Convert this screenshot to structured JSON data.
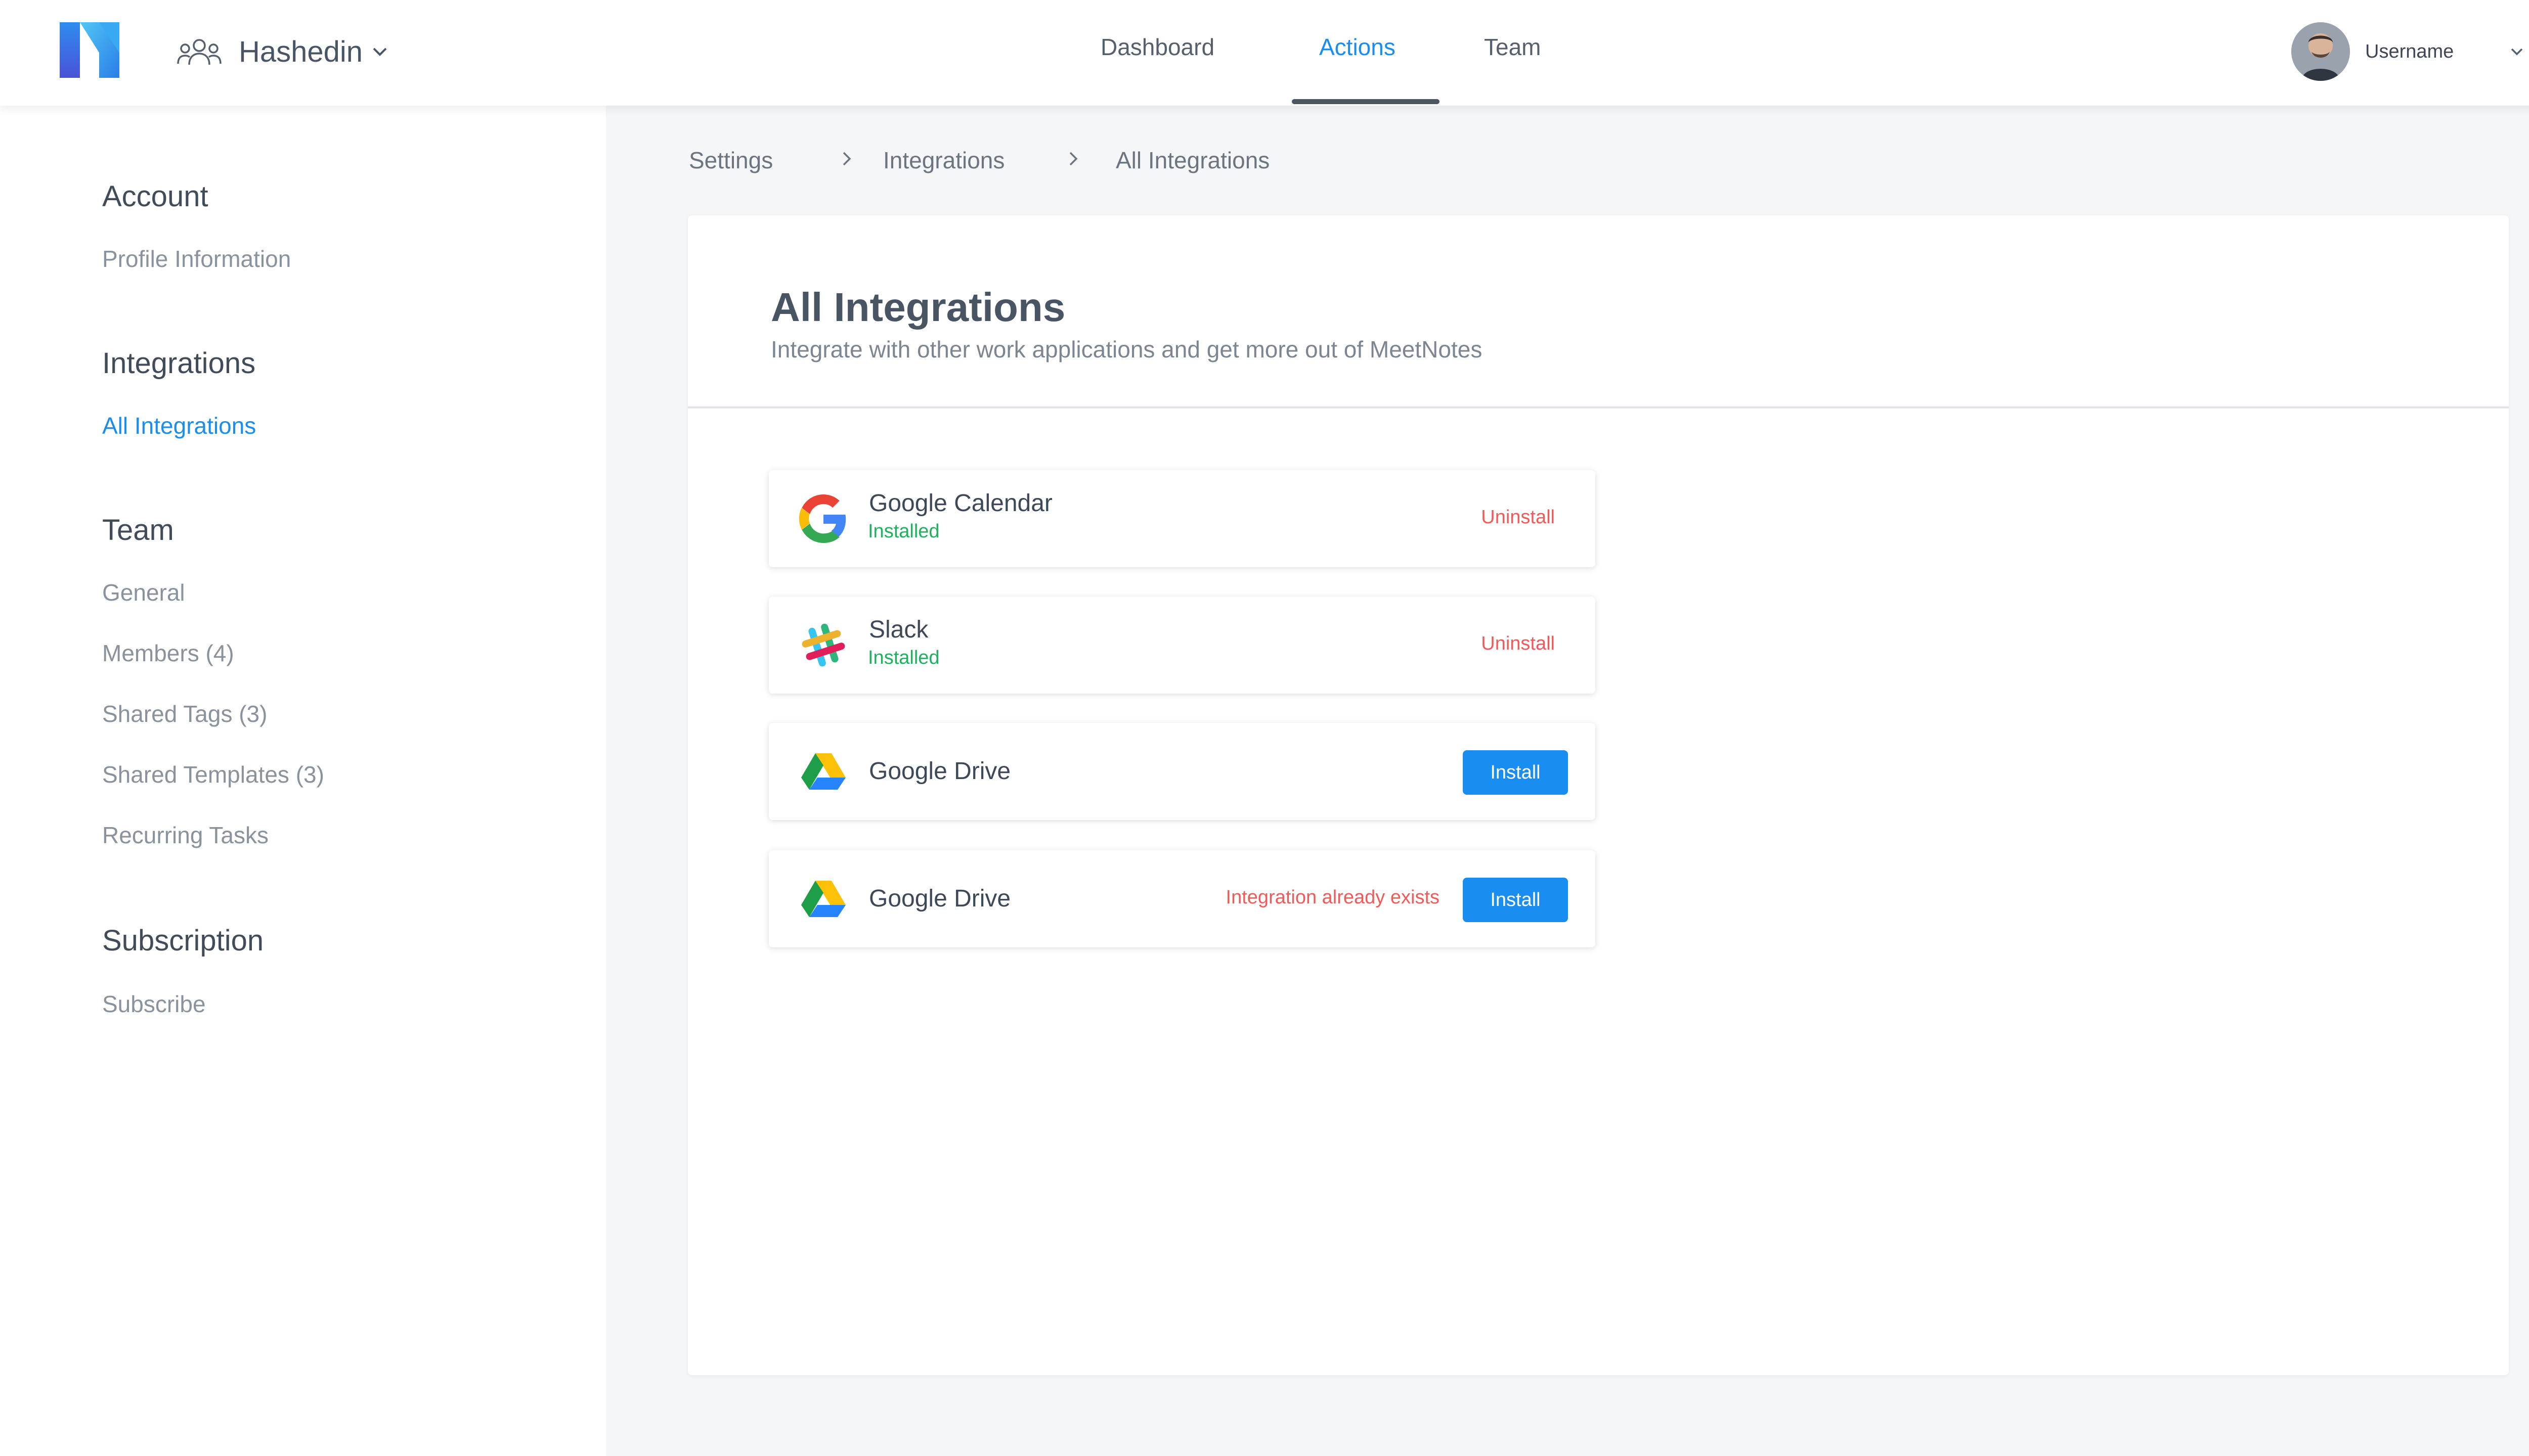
{
  "header": {
    "team_name": "Hashedin",
    "tabs": [
      {
        "label": "Dashboard",
        "active": false
      },
      {
        "label": "Actions",
        "active": true
      },
      {
        "label": "Team",
        "active": false
      }
    ],
    "username": "Username",
    "accent_color": "#1a8df0"
  },
  "sidebar": {
    "sections": [
      {
        "title": "Account",
        "items": [
          {
            "label": "Profile Information"
          }
        ]
      },
      {
        "title": "Integrations",
        "items": [
          {
            "label": "All Integrations",
            "active": true
          }
        ]
      },
      {
        "title": "Team",
        "items": [
          {
            "label": "General"
          },
          {
            "label": "Members (4)"
          },
          {
            "label": "Shared Tags (3)"
          },
          {
            "label": "Shared Templates (3)"
          },
          {
            "label": "Recurring Tasks"
          }
        ]
      },
      {
        "title": "Subscription",
        "items": [
          {
            "label": "Subscribe"
          }
        ]
      }
    ]
  },
  "breadcrumb": [
    "Settings",
    "Integrations",
    "All Integrations"
  ],
  "main": {
    "title": "All Integrations",
    "subtitle": "Integrate with other work applications and get more out of MeetNotes",
    "integrations": [
      {
        "name": "Google Calendar",
        "icon": "google-icon",
        "status": "Installed",
        "action": "Uninstall"
      },
      {
        "name": "Slack",
        "icon": "slack-icon",
        "status": "Installed",
        "action": "Uninstall"
      },
      {
        "name": "Google Drive",
        "icon": "google-drive-icon",
        "action": "Install"
      },
      {
        "name": "Google Drive",
        "icon": "google-drive-icon",
        "message": "Integration already exists",
        "action": "Install"
      }
    ]
  }
}
